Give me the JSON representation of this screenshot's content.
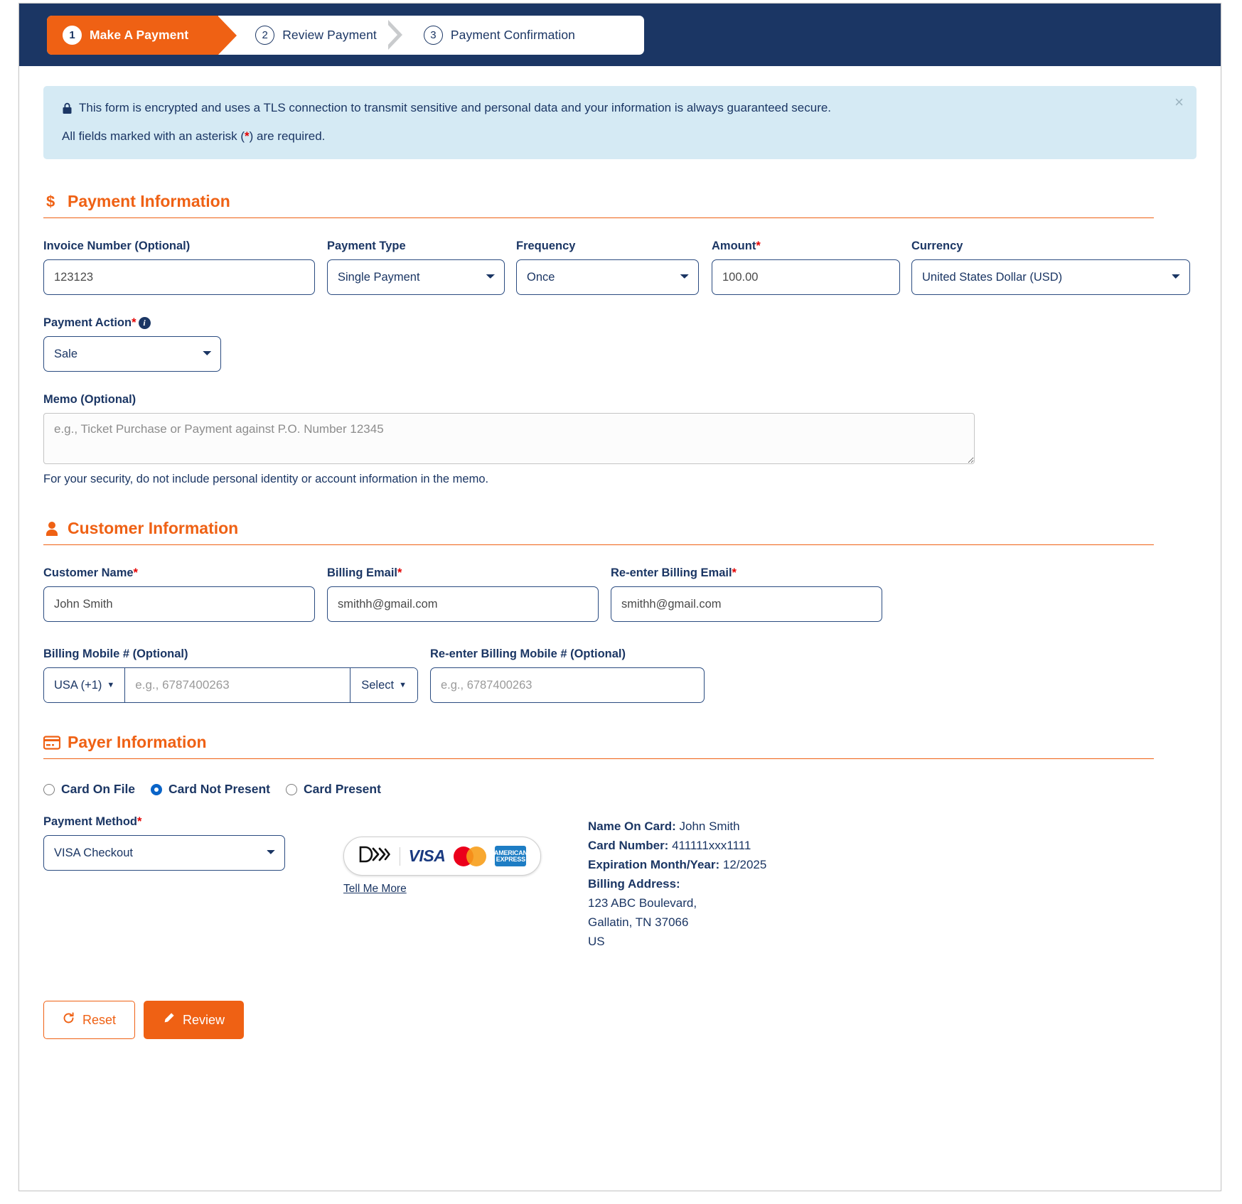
{
  "stepper": {
    "steps": [
      {
        "num": "1",
        "label": "Make A Payment",
        "active": true
      },
      {
        "num": "2",
        "label": "Review Payment",
        "active": false
      },
      {
        "num": "3",
        "label": "Payment Confirmation",
        "active": false
      }
    ]
  },
  "alert": {
    "line1": "This form is encrypted and uses a TLS connection to transmit sensitive and personal data and your information is always guaranteed secure.",
    "line2_before": "All fields marked with an asterisk (",
    "line2_star": "*",
    "line2_after": ") are required.",
    "close_label": "×",
    "lock_icon": "lock-icon"
  },
  "payment_information": {
    "heading": "Payment Information",
    "icon": "dollar-sign-icon",
    "invoice_number": {
      "label": "Invoice Number (Optional)",
      "value": "123123"
    },
    "payment_type": {
      "label": "Payment Type",
      "value": "Single Payment"
    },
    "frequency": {
      "label": "Frequency",
      "value": "Once"
    },
    "amount": {
      "label": "Amount",
      "required": "*",
      "value": "100.00"
    },
    "currency": {
      "label": "Currency",
      "value": "United States Dollar (USD)"
    },
    "payment_action": {
      "label": "Payment Action",
      "required": "*",
      "value": "Sale"
    },
    "memo": {
      "label": "Memo (Optional)",
      "placeholder": "e.g., Ticket Purchase or Payment against P.O. Number 12345",
      "value": "",
      "helper": "For your security, do not include personal identity or account information in the memo."
    }
  },
  "customer_information": {
    "heading": "Customer Information",
    "icon": "user-icon",
    "customer_name": {
      "label": "Customer Name",
      "required": "*",
      "value": "John Smith"
    },
    "billing_email": {
      "label": "Billing Email",
      "required": "*",
      "value": "smithh@gmail.com"
    },
    "reenter_billing_email": {
      "label": "Re-enter Billing Email",
      "required": "*",
      "value": "smithh@gmail.com"
    },
    "billing_mobile": {
      "label": "Billing Mobile # (Optional)",
      "country_code": "USA (+1)",
      "placeholder": "e.g., 6787400263",
      "value": "",
      "carrier_select": "Select"
    },
    "reenter_billing_mobile": {
      "label": "Re-enter Billing Mobile # (Optional)",
      "placeholder": "e.g., 6787400263",
      "value": ""
    }
  },
  "payer_information": {
    "heading": "Payer Information",
    "icon": "credit-card-icon",
    "payer_options": [
      {
        "label": "Card On File",
        "selected": false
      },
      {
        "label": "Card Not Present",
        "selected": true
      },
      {
        "label": "Card Present",
        "selected": false
      }
    ],
    "payment_method": {
      "label": "Payment Method",
      "required": "*",
      "value": "VISA Checkout"
    },
    "card_brands": {
      "visa": "VISA",
      "amex_line1": "AMERICAN",
      "amex_line2": "EXPRESS",
      "mastercard": "mastercard-icon",
      "checkout": "visa-checkout-icon"
    },
    "tell_me_more": "Tell Me More",
    "card_details": {
      "name_on_card_label": "Name On Card:",
      "name_on_card_value": "John Smith",
      "card_number_label": "Card Number:",
      "card_number_value": "411111xxx1111",
      "expiration_label": "Expiration Month/Year:",
      "expiration_value": "12/2025",
      "billing_address_label": "Billing Address:",
      "address_line1": "123 ABC Boulevard,",
      "address_line2": "Gallatin, TN 37066",
      "address_line3": "US"
    }
  },
  "actions": {
    "reset": "Reset",
    "review": "Review",
    "reset_icon": "refresh-icon",
    "review_icon": "pencil-icon"
  },
  "colors": {
    "brand_orange": "#ef6114",
    "brand_navy": "#1b3664",
    "required_red": "#e40000",
    "alert_bg": "#d5eaf4"
  }
}
